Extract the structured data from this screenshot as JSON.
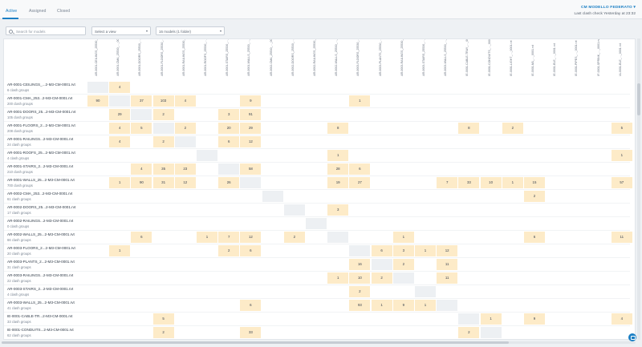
{
  "tabs": [
    {
      "label": "Active",
      "active": true
    },
    {
      "label": "Assigned",
      "active": false
    },
    {
      "label": "Closed",
      "active": false
    }
  ],
  "project": {
    "name": "CM MODELLO FEDERATO ▾"
  },
  "last_check": "Last clash check Yesterday at 23:32",
  "search": {
    "placeholder": "Search for models"
  },
  "view_select": {
    "value": "Select a view"
  },
  "models_select": {
    "value": "16 models (1 folder)"
  },
  "columns": [
    "AR-0001-CEILINGS_25530_..._0001.rvt",
    "AR-0001-CMA_25530_..._0001.rvt",
    "AR-0001-DOORS_25530_..._0001.rvt",
    "AR-0001-FLOORS_25530_..._0001.rvt",
    "AR-0001-RAILINGS_25530_..._0001.rvt",
    "AR-0001-ROOFS_25530_..._0001.rvt",
    "AR-0001-STAIRS_25530_..._0001.rvt",
    "AR-0001-WALLS_25530_..._0001.rvt",
    "AR-0002-CMA_25530_..._0001.rvt",
    "AR-0002-DOORS_25530_..._0001.rvt",
    "AR-0002-RAILINGS_25530_..._0001.rvt",
    "AR-0002-WALLS_25530_..._0001.rvt",
    "AR-0003-FLOORS_25530_..._0001.rvt",
    "AR-0003-PLANTS_25530_..._0001.rvt",
    "AR-0003-RAILINGS_25530_..._0001.rvt",
    "AR-0003-STAIRS_25530_..._0001.rvt",
    "AR-0003-WALLS_25530_..._0001.rvt",
    "IE-0001-CABLE-TRAY_..._0001.rvt",
    "IE-0001-CONDUITS_..._0001.rvt",
    "IE-0001-LIGHT_..._0001.rvt",
    "IE-0001-M1_..._0001.rvt",
    "IE-0001-ELE_..._0001.rvt",
    "IE-0001-PIPES_..._0001.rvt",
    "IF-0001-SPRINK_..._0001.rvt",
    "IA-0001-ELE_..._0001.rvt"
  ],
  "rows": [
    {
      "name": "AR-0001-CEILINGS_...2-M3-CM-0001.rvt",
      "sub": "6 clash groups",
      "cells": {
        "1": "4"
      }
    },
    {
      "name": "AR-0001-CMA_253...2-M3-CM-0001.rvt",
      "sub": "200 clash groups",
      "cells": {
        "0": "90",
        "2": "37",
        "3": "103",
        "4": "4",
        "7": "9",
        "12": "1"
      }
    },
    {
      "name": "AR-0001-DOORS_25...2-M3-CM-0001.rvt",
      "sub": "105 clash groups",
      "cells": {
        "1": "29",
        "3": "2",
        "6": "3",
        "7": "91"
      }
    },
    {
      "name": "AR-0001-FLOORS_2...2-M3-CM-0001.rvt",
      "sub": "208 clash groups",
      "cells": {
        "1": "4",
        "2": "5",
        "4": "2",
        "6": "20",
        "7": "29",
        "11": "8",
        "17": "8",
        "19": "2",
        "24": "5"
      }
    },
    {
      "name": "AR-0001-RAILINGS...2-M3-CM-0001.rvt",
      "sub": "24 clash groups",
      "cells": {
        "1": "4",
        "3": "2",
        "6": "6",
        "7": "12"
      }
    },
    {
      "name": "AR-0001-ROOFS_25...2-M3-CM-0001.rvt",
      "sub": "4 clash groups",
      "cells": {
        "11": "1",
        "24": "1"
      }
    },
    {
      "name": "AR-0001-STAIRS_2...2-M3-CM-0001.rvt",
      "sub": "210 clash groups",
      "cells": {
        "2": "4",
        "3": "35",
        "4": "23",
        "7": "58",
        "11": "28",
        "12": "6"
      }
    },
    {
      "name": "AR-0001-WALLS_25...2-M3-CM-0001.rvt",
      "sub": "700 clash groups",
      "cells": {
        "1": "1",
        "2": "90",
        "3": "31",
        "4": "12",
        "6": "26",
        "11": "19",
        "12": "27",
        "16": "7",
        "17": "33",
        "18": "10",
        "19": "1",
        "20": "15",
        "24": "57"
      }
    },
    {
      "name": "AR-0002-CMA_253...2-M3-CM-0001.rvt",
      "sub": "61 clash groups",
      "cells": {
        "20": "2"
      }
    },
    {
      "name": "AR-0002-DOORS_25...2-M3-CM-0001.rvt",
      "sub": "17 clash groups",
      "cells": {
        "11": "3"
      }
    },
    {
      "name": "AR-0002-RAILINGS...2-M3-CM-0001.rvt",
      "sub": "0 clash groups",
      "cells": {}
    },
    {
      "name": "AR-0002-WALLS_25...2-M3-CM-0001.rvt",
      "sub": "66 clash groups",
      "cells": {
        "2": "6",
        "5": "1",
        "6": "7",
        "7": "12",
        "9": "2",
        "14": "1",
        "20": "6",
        "24": "11"
      }
    },
    {
      "name": "AR-0003-FLOORS_2...2-M3-CM-0001.rvt",
      "sub": "20 clash groups",
      "cells": {
        "1": "1",
        "6": "2",
        "7": "6",
        "13": "6",
        "14": "3",
        "15": "1",
        "16": "12"
      }
    },
    {
      "name": "AR-0003-PLANTS_2...2-M3-CM-0001.rvt",
      "sub": "31 clash groups",
      "cells": {
        "12": "16",
        "14": "2",
        "16": "11"
      }
    },
    {
      "name": "AR-0003-RAILINGS...2-M3-CM-0001.rvt",
      "sub": "22 clash groups",
      "cells": {
        "11": "1",
        "12": "10",
        "13": "2",
        "16": "11"
      }
    },
    {
      "name": "AR-0003-STAIRS_2...2-M3-CM-0001.rvt",
      "sub": "4 clash groups",
      "cells": {
        "12": "2"
      }
    },
    {
      "name": "AR-0003-WALLS_25...2-M3-CM-0001.rvt",
      "sub": "41 clash groups",
      "cells": {
        "7": "6",
        "12": "93",
        "13": "1",
        "14": "9",
        "15": "1"
      }
    },
    {
      "name": "IE-0001-CABLE-TR...2-M3-CM-0001.rvt",
      "sub": "33 clash groups",
      "cells": {
        "3": "5",
        "18": "1",
        "20": "9",
        "24": "4"
      }
    },
    {
      "name": "IE-0001-CONDUITS...2-M3-CM-0001.rvt",
      "sub": "62 clash groups",
      "cells": {
        "3": "2",
        "7": "33",
        "17": "2"
      }
    }
  ]
}
